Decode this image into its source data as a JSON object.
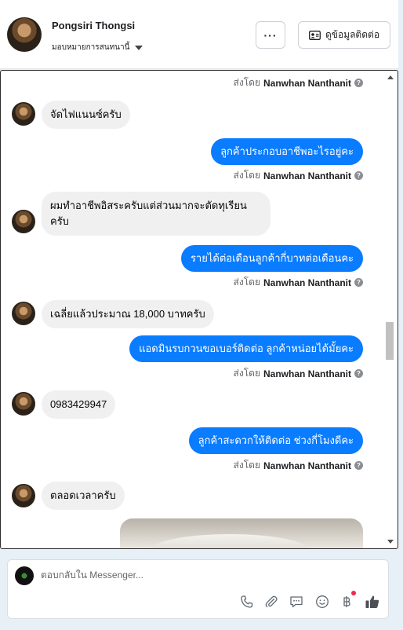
{
  "header": {
    "contact_name": "Pongsiri Thongsi",
    "assign_label": "มอบหมายการสนทนานี้",
    "more_label": "···",
    "view_contact_label": "ดูข้อมูลติดต่อ"
  },
  "thread": {
    "sent_by_prefix": "ส่งโดย",
    "sender": "Nanwhan Nanthanit",
    "messages": [
      {
        "text": "จัดไฟแนนซ์ครับ"
      },
      {
        "text": "ลูกค้าประกอบอาชีพอะไรอยู่คะ"
      },
      {
        "text": "ผมทำอาชีพอิสระครับแต่ส่วนมากจะตัดทุเรียน ครับ"
      },
      {
        "text": "รายได้ต่อเดือนลูกค้ากี่บาทต่อเดือนคะ"
      },
      {
        "text": "เฉลี่ยแล้วประมาณ 18,000 บาทครับ"
      },
      {
        "text": "แอดมินรบกวนขอเบอร์ติดต่อ ลูกค้าหน่อยได้มั้ยคะ"
      },
      {
        "text": "0983429947"
      },
      {
        "text": "ลูกค้าสะดวกให้ติดต่อ ช่วงกี่โมงดีคะ"
      },
      {
        "text": "ตลอดเวลาครับ"
      }
    ]
  },
  "composer": {
    "placeholder": "ตอบกลับใน Messenger..."
  },
  "colors": {
    "accent": "#0a7cff",
    "incoming_bubble": "#f0f0f0",
    "notification": "#f02849"
  }
}
